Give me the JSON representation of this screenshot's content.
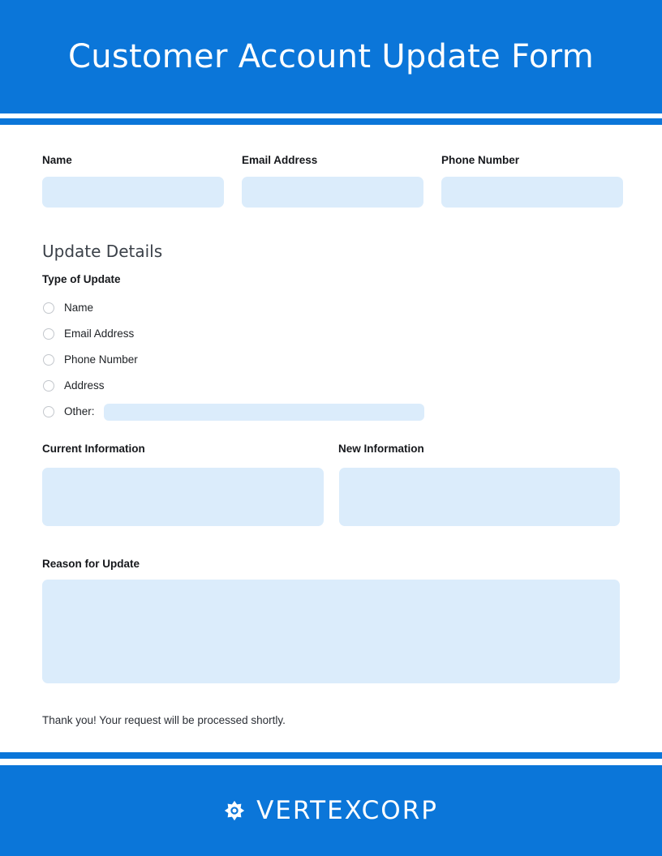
{
  "header": {
    "title": "Customer Account Update Form"
  },
  "contact_fields": [
    {
      "label": "Name",
      "value": "",
      "placeholder": ""
    },
    {
      "label": "Email Address",
      "value": "",
      "placeholder": ""
    },
    {
      "label": "Phone Number",
      "value": "",
      "placeholder": ""
    }
  ],
  "update_details": {
    "heading": "Update Details",
    "type_label": "Type of Update",
    "options": [
      {
        "label": "Name",
        "selected": false
      },
      {
        "label": "Email Address",
        "selected": false
      },
      {
        "label": "Phone Number",
        "selected": false
      },
      {
        "label": "Address",
        "selected": false
      },
      {
        "label": "Other:",
        "selected": false,
        "has_input": true,
        "value": ""
      }
    ]
  },
  "information": {
    "current_label": "Current Information",
    "current_value": "",
    "new_label": "New Information",
    "new_value": ""
  },
  "reason": {
    "label": "Reason for Update",
    "value": ""
  },
  "note": {
    "text": "Thank you! Your request will be processed shortly."
  },
  "footer": {
    "brand": "VERTEXCORP",
    "logo_icon": "gear-star-icon"
  },
  "colors": {
    "accent_blue": "#0b76d9",
    "input_fill": "#dbecfb",
    "heading_gray": "#3b4149",
    "text_dark": "#16181c",
    "radio_border": "#c3c7cc"
  }
}
